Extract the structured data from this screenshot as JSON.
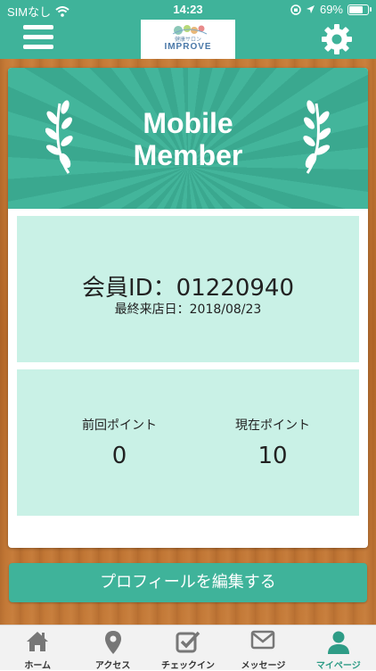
{
  "status_bar": {
    "carrier": "SIMなし",
    "time": "14:23",
    "battery_percent": "69%",
    "battery_level": 0.69
  },
  "header": {
    "logo_small": "健康サロン",
    "logo_big": "IMPROVE"
  },
  "banner": {
    "title_line1": "Mobile",
    "title_line2": "Member"
  },
  "member": {
    "id_text": "会員ID：01220940",
    "last_visit": "最終来店日：2018/08/23"
  },
  "points": {
    "previous_label": "前回ポイント",
    "previous_value": "0",
    "current_label": "現在ポイント",
    "current_value": "10"
  },
  "actions": {
    "edit_profile": "プロフィールを編集する"
  },
  "tabs": [
    {
      "label": "ホーム",
      "icon": "home-icon"
    },
    {
      "label": "アクセス",
      "icon": "map-pin-icon"
    },
    {
      "label": "チェックイン",
      "icon": "checkin-icon"
    },
    {
      "label": "メッセージ",
      "icon": "mail-icon"
    },
    {
      "label": "マイページ",
      "icon": "user-icon"
    }
  ],
  "colors": {
    "brand": "#3fb39a",
    "panel": "#c9f1e6",
    "active_tab": "#2e9c86"
  }
}
